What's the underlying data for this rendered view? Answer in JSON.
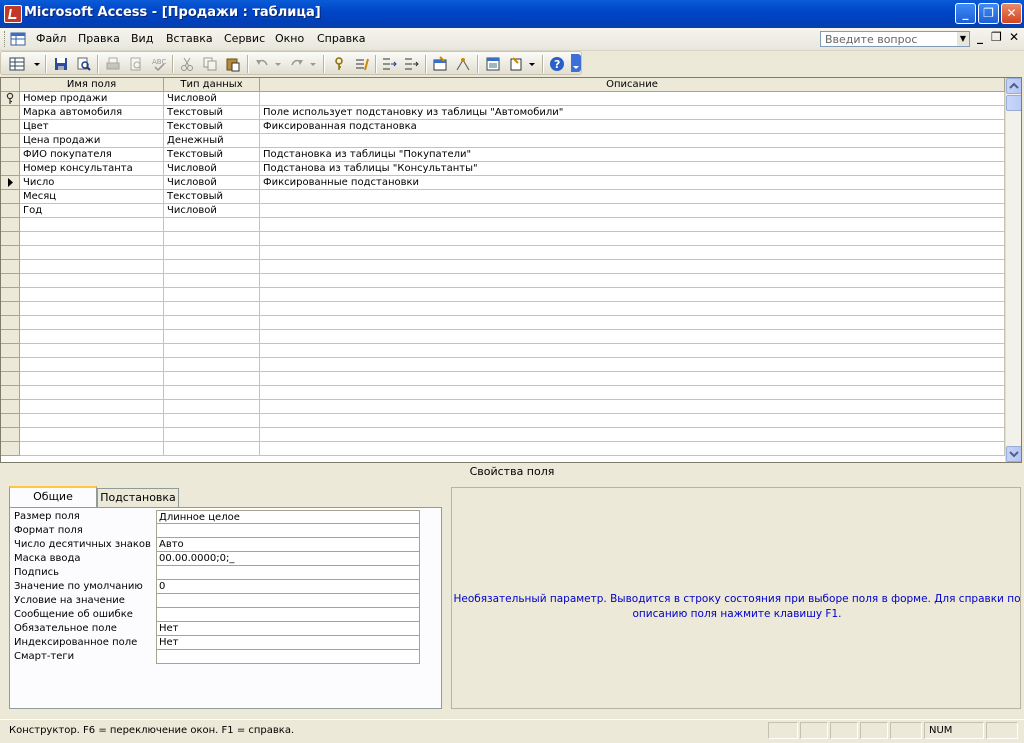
{
  "title": "Microsoft Access - [Продажи : таблица]",
  "window_controls": {
    "minimize": "_",
    "restore": "❐",
    "close": "✕"
  },
  "menu": {
    "items": [
      "Файл",
      "Правка",
      "Вид",
      "Вставка",
      "Сервис",
      "Окно",
      "Справка"
    ],
    "help_placeholder": "Введите вопрос",
    "doc_controls": {
      "minimize": "_",
      "restore": "❐",
      "close": "✕"
    }
  },
  "toolbar": {
    "icons": [
      "view-icon",
      "dropdown-icon",
      "save-icon",
      "search-icon",
      "print-icon",
      "print-preview-icon",
      "spelling-icon",
      "cut-icon",
      "copy-icon",
      "paste-icon",
      "undo-icon",
      "undo-dropdown-icon",
      "redo-icon",
      "redo-dropdown-icon",
      "primary-key-icon",
      "indexes-icon",
      "insert-rows-icon",
      "delete-rows-icon",
      "properties-icon",
      "build-icon",
      "database-window-icon",
      "new-object-icon",
      "new-object-dropdown-icon",
      "help-icon"
    ]
  },
  "grid": {
    "columns": [
      "Имя поля",
      "Тип данных",
      "Описание"
    ],
    "rows": [
      {
        "name": "Номер продажи",
        "type": "Числовой",
        "desc": "",
        "marker": "key"
      },
      {
        "name": "Марка автомобиля",
        "type": "Текстовый",
        "desc": "Поле использует подстановку из таблицы \"Автомобили\"",
        "marker": ""
      },
      {
        "name": "Цвет",
        "type": "Текстовый",
        "desc": "Фиксированная подстановка",
        "marker": ""
      },
      {
        "name": "Цена продажи",
        "type": "Денежный",
        "desc": "",
        "marker": ""
      },
      {
        "name": "ФИО покупателя",
        "type": "Текстовый",
        "desc": "Подстановка из таблицы \"Покупатели\"",
        "marker": ""
      },
      {
        "name": "Номер консультанта",
        "type": "Числовой",
        "desc": "Подстанова из таблицы \"Консультанты\"",
        "marker": ""
      },
      {
        "name": "Число",
        "type": "Числовой",
        "desc": "Фиксированные подстановки",
        "marker": "current"
      },
      {
        "name": "Месяц",
        "type": "Текстовый",
        "desc": "",
        "marker": ""
      },
      {
        "name": "Год",
        "type": "Числовой",
        "desc": "",
        "marker": ""
      }
    ],
    "empty_rows": 17
  },
  "field_properties": {
    "header": "Свойства поля",
    "tabs": [
      "Общие",
      "Подстановка"
    ],
    "active_tab": 0,
    "properties": [
      {
        "label": "Размер поля",
        "value": "Длинное целое"
      },
      {
        "label": "Формат поля",
        "value": ""
      },
      {
        "label": "Число десятичных знаков",
        "value": "Авто"
      },
      {
        "label": "Маска ввода",
        "value": "00.00.0000;0;_"
      },
      {
        "label": "Подпись",
        "value": ""
      },
      {
        "label": "Значение по умолчанию",
        "value": "0"
      },
      {
        "label": "Условие на значение",
        "value": ""
      },
      {
        "label": "Сообщение об ошибке",
        "value": ""
      },
      {
        "label": "Обязательное поле",
        "value": "Нет"
      },
      {
        "label": "Индексированное поле",
        "value": "Нет"
      },
      {
        "label": "Смарт-теги",
        "value": ""
      }
    ],
    "help_text_line1": "Необязательный параметр.  Выводится в строку состояния при выборе поля в форме.  Для справки по",
    "help_text_line2": "описанию поля нажмите клавишу F1."
  },
  "statusbar": {
    "message": "Конструктор.  F6 = переключение окон.  F1 = справка.",
    "num": "NUM"
  },
  "colors": {
    "titlebar": "#0046c8",
    "help_text": "#0000c8",
    "tab_highlight": "#ffc83c"
  }
}
